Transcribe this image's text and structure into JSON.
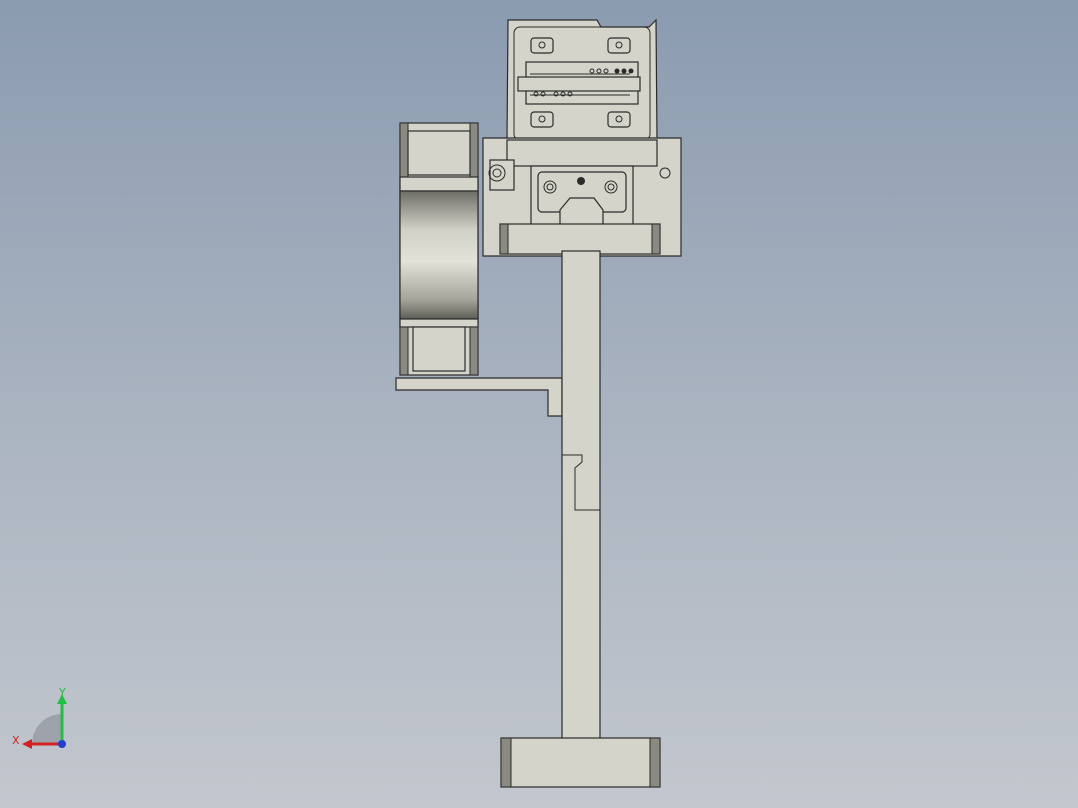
{
  "viewport": {
    "background_top": "#8b9bb0",
    "background_bottom": "#c3c7ce",
    "part_fill": "#d4d4ca",
    "edge_color": "#2b2b2b"
  },
  "triad": {
    "x_label": "X",
    "y_label": "Y",
    "x_color": "#d42020",
    "y_color": "#20c040",
    "z_color": "#2040d0"
  }
}
